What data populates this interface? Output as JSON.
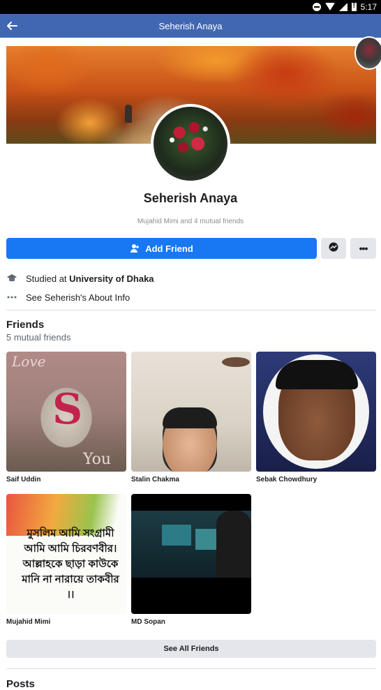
{
  "status_bar": {
    "time": "5:17"
  },
  "appbar": {
    "title": "Seherish Anaya"
  },
  "profile": {
    "name": "Seherish Anaya",
    "mutual_text": "Mujahid Mimi and 4 mutual friends"
  },
  "actions": {
    "add_friend_label": "Add Friend",
    "more_label": "•••"
  },
  "info": {
    "studied_prefix": "Studied at ",
    "studied_school": "University of Dhaka",
    "about_text": "See Seherish's About Info"
  },
  "friends": {
    "title": "Friends",
    "subtitle": "5 mutual friends",
    "items": [
      {
        "name": "Saif Uddin"
      },
      {
        "name": "Stalin Chakma"
      },
      {
        "name": "Sebak Chowdhury"
      },
      {
        "name": "Mujahid Mimi"
      },
      {
        "name": "MD Sopan"
      }
    ],
    "see_all_label": "See All Friends",
    "photo1_text": {
      "love": "Love",
      "s": "S",
      "you": "You"
    },
    "photo4_text": "মুসলিম আমি সংগ্রামী আমি আমি চিরবণবীর। আল্লাহকে ছাড়া কাউকে মানি না নারায়ে তাকবীর ।।"
  },
  "posts": {
    "title": "Posts"
  },
  "colors": {
    "appbar": "#4267b2",
    "primary": "#1877f2",
    "secondary_button": "#e4e6eb"
  }
}
